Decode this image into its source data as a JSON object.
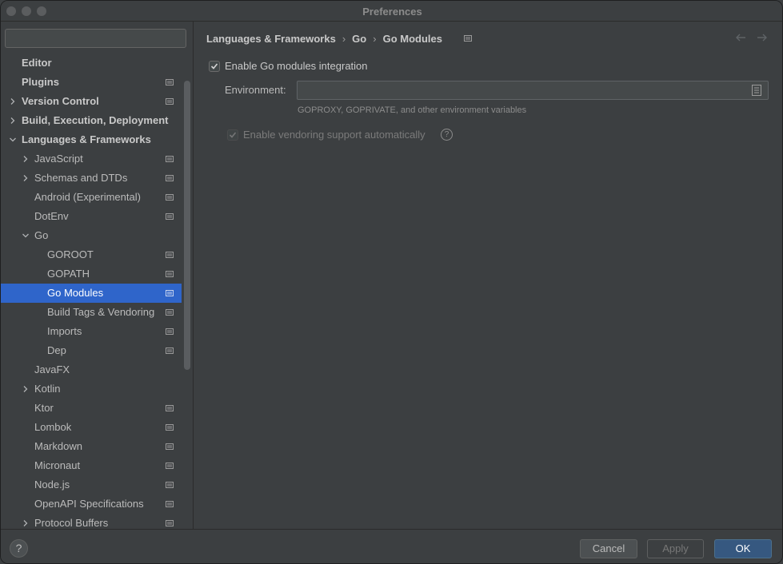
{
  "window": {
    "title": "Preferences"
  },
  "sidebar": {
    "search": {
      "value": "",
      "placeholder": ""
    },
    "items": [
      {
        "label": "Editor",
        "level": 0,
        "bold": true,
        "chevron": "",
        "project": false
      },
      {
        "label": "Plugins",
        "level": 0,
        "bold": true,
        "chevron": "",
        "project": true
      },
      {
        "label": "Version Control",
        "level": 0,
        "bold": true,
        "chevron": "right",
        "project": true
      },
      {
        "label": "Build, Execution, Deployment",
        "level": 0,
        "bold": true,
        "chevron": "right",
        "project": false
      },
      {
        "label": "Languages & Frameworks",
        "level": 0,
        "bold": true,
        "chevron": "down",
        "project": false
      },
      {
        "label": "JavaScript",
        "level": 1,
        "bold": false,
        "chevron": "right",
        "project": true
      },
      {
        "label": "Schemas and DTDs",
        "level": 1,
        "bold": false,
        "chevron": "right",
        "project": true
      },
      {
        "label": "Android (Experimental)",
        "level": 1,
        "bold": false,
        "chevron": "",
        "project": true
      },
      {
        "label": "DotEnv",
        "level": 1,
        "bold": false,
        "chevron": "",
        "project": true
      },
      {
        "label": "Go",
        "level": 1,
        "bold": false,
        "chevron": "down",
        "project": false
      },
      {
        "label": "GOROOT",
        "level": 2,
        "bold": false,
        "chevron": "",
        "project": true
      },
      {
        "label": "GOPATH",
        "level": 2,
        "bold": false,
        "chevron": "",
        "project": true
      },
      {
        "label": "Go Modules",
        "level": 2,
        "bold": false,
        "chevron": "",
        "project": true,
        "selected": true
      },
      {
        "label": "Build Tags & Vendoring",
        "level": 2,
        "bold": false,
        "chevron": "",
        "project": true
      },
      {
        "label": "Imports",
        "level": 2,
        "bold": false,
        "chevron": "",
        "project": true
      },
      {
        "label": "Dep",
        "level": 2,
        "bold": false,
        "chevron": "",
        "project": true
      },
      {
        "label": "JavaFX",
        "level": 1,
        "bold": false,
        "chevron": "",
        "project": false
      },
      {
        "label": "Kotlin",
        "level": 1,
        "bold": false,
        "chevron": "right",
        "project": false
      },
      {
        "label": "Ktor",
        "level": 1,
        "bold": false,
        "chevron": "",
        "project": true
      },
      {
        "label": "Lombok",
        "level": 1,
        "bold": false,
        "chevron": "",
        "project": true
      },
      {
        "label": "Markdown",
        "level": 1,
        "bold": false,
        "chevron": "",
        "project": true
      },
      {
        "label": "Micronaut",
        "level": 1,
        "bold": false,
        "chevron": "",
        "project": true
      },
      {
        "label": "Node.js",
        "level": 1,
        "bold": false,
        "chevron": "",
        "project": true
      },
      {
        "label": "OpenAPI Specifications",
        "level": 1,
        "bold": false,
        "chevron": "",
        "project": true
      },
      {
        "label": "Protocol Buffers",
        "level": 1,
        "bold": false,
        "chevron": "right",
        "project": true
      }
    ]
  },
  "breadcrumb": {
    "items": [
      "Languages & Frameworks",
      "Go",
      "Go Modules"
    ],
    "separator": "›"
  },
  "settings": {
    "enable_modules": {
      "label": "Enable Go modules integration",
      "checked": true
    },
    "environment": {
      "label": "Environment:",
      "value": "",
      "hint": "GOPROXY, GOPRIVATE, and other environment variables"
    },
    "vendoring": {
      "label": "Enable vendoring support automatically",
      "checked": true,
      "disabled": true,
      "help": "?"
    }
  },
  "footer": {
    "help": "?",
    "cancel": "Cancel",
    "apply": "Apply",
    "ok": "OK"
  },
  "colors": {
    "selection": "#2f65ca",
    "ok_button": "#365880",
    "background": "#3c3f41"
  }
}
